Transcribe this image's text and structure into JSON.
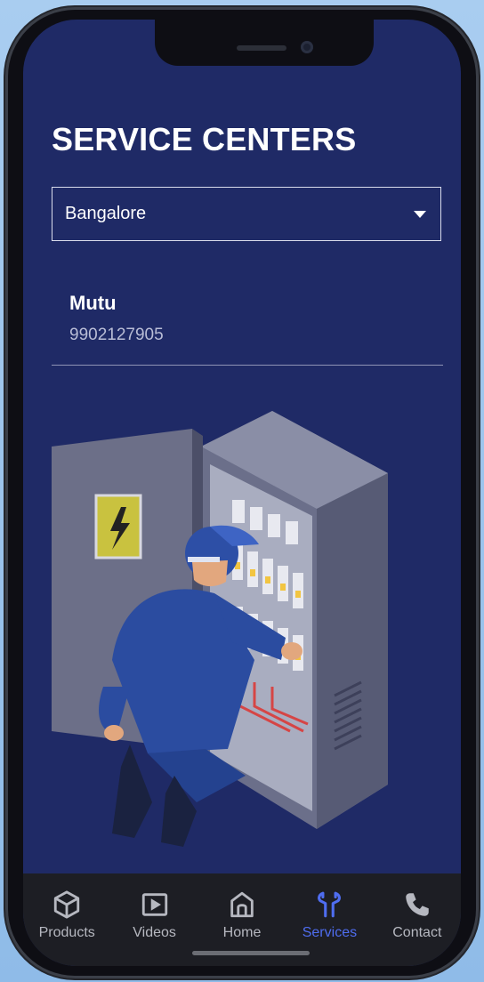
{
  "page": {
    "title": "SERVICE CENTERS"
  },
  "city_select": {
    "value": "Bangalore",
    "icon": "caret-down-icon"
  },
  "service_centers": [
    {
      "name": "Mutu",
      "phone": "9902127905"
    }
  ],
  "illustration": {
    "subject": "technician-at-electrical-panel"
  },
  "tabs": [
    {
      "label": "Products",
      "icon": "box-icon",
      "active": false
    },
    {
      "label": "Videos",
      "icon": "play-icon",
      "active": false
    },
    {
      "label": "Home",
      "icon": "home-icon",
      "active": false
    },
    {
      "label": "Services",
      "icon": "wrench-icon",
      "active": true
    },
    {
      "label": "Contact",
      "icon": "phone-icon",
      "active": false
    }
  ],
  "colors": {
    "background": "#1f2a66",
    "active_tab": "#4f6df0",
    "tabbar": "#1d1e24"
  }
}
